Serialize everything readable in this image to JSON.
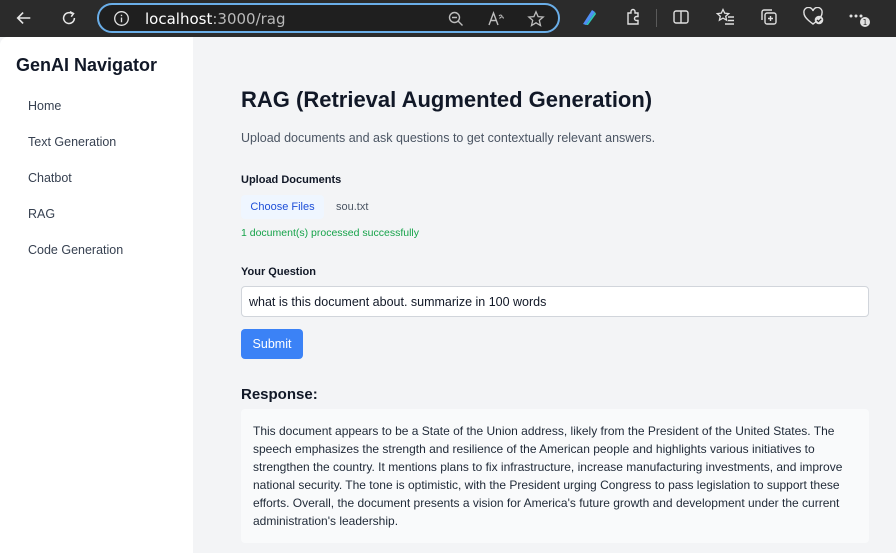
{
  "browser": {
    "url_host": "localhost",
    "url_path": ":3000/rag"
  },
  "sidebar": {
    "brand": "GenAI Navigator",
    "items": [
      {
        "label": "Home"
      },
      {
        "label": "Text Generation"
      },
      {
        "label": "Chatbot"
      },
      {
        "label": "RAG"
      },
      {
        "label": "Code Generation"
      }
    ]
  },
  "main": {
    "title": "RAG (Retrieval Augmented Generation)",
    "description": "Upload documents and ask questions to get contextually relevant answers.",
    "upload_label": "Upload Documents",
    "choose_files_label": "Choose Files",
    "file_name": "sou.txt",
    "success_message": "1 document(s) processed successfully",
    "question_label": "Your Question",
    "question_value": "what is this document about. summarize in 100 words",
    "submit_label": "Submit",
    "response_title": "Response:",
    "response_text": "This document appears to be a State of the Union address, likely from the President of the United States. The speech emphasizes the strength and resilience of the American people and highlights various initiatives to strengthen the country. It mentions plans to fix infrastructure, increase manufacturing investments, and improve national security. The tone is optimistic, with the President urging Congress to pass legislation to support these efforts. Overall, the document presents a vision for America's future growth and development under the current administration's leadership."
  },
  "colors": {
    "accent": "#3b82f6",
    "success": "#16a34a",
    "chrome": "#2b2b2b",
    "address_border": "#6aaee8"
  },
  "icons": [
    "back-icon",
    "refresh-icon",
    "info-icon",
    "zoom-out-icon",
    "read-aloud-icon",
    "favorite-star-icon",
    "copilot-icon",
    "extensions-icon",
    "split-screen-icon",
    "favorites-icon",
    "collections-icon",
    "browser-essentials-icon",
    "more-icon"
  ]
}
